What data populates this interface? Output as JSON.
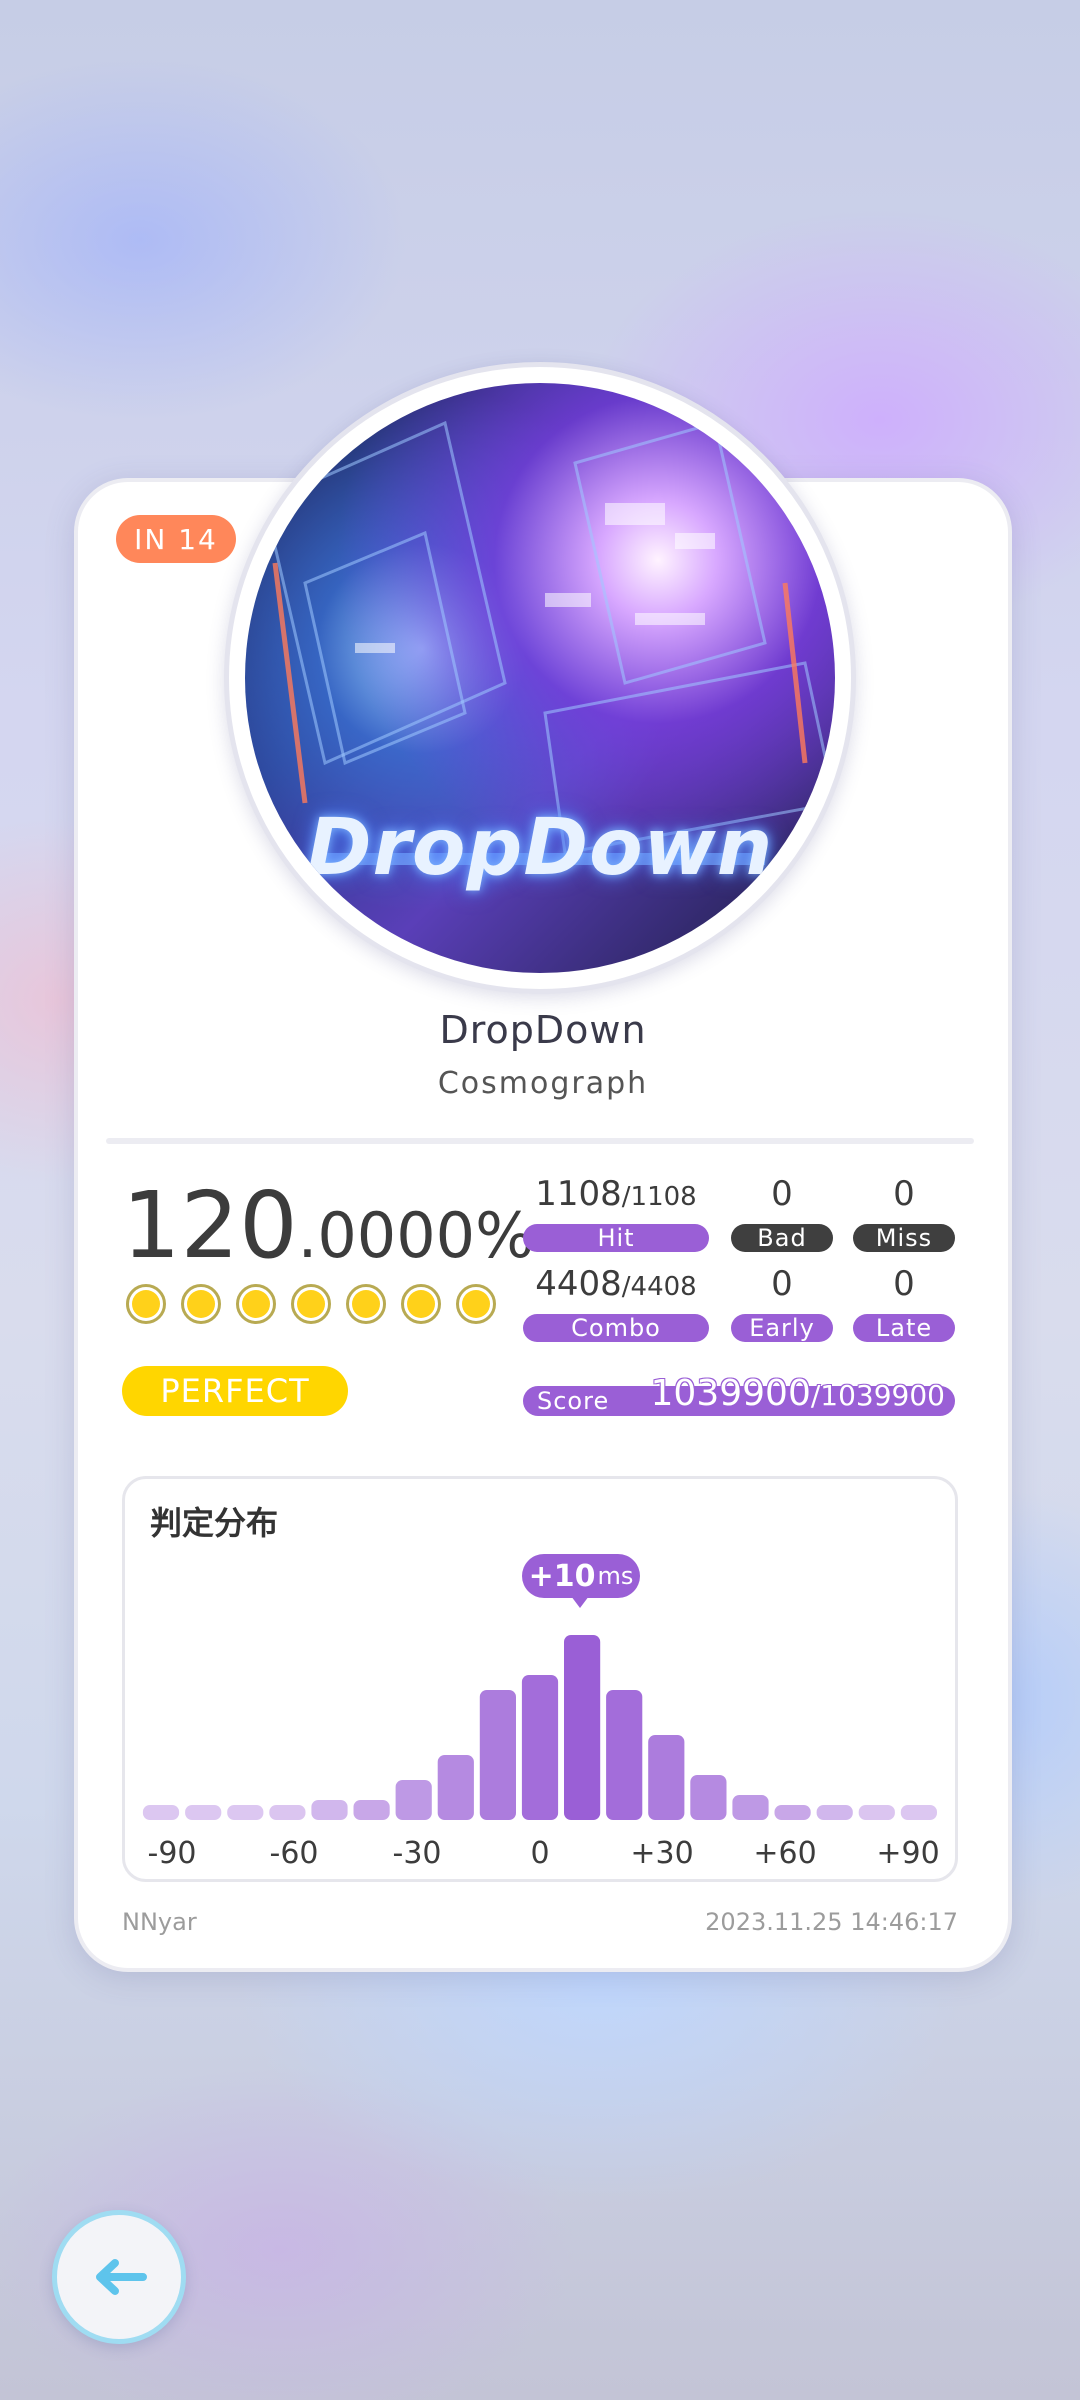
{
  "level": "IN  14",
  "song": {
    "jacket_text": "DropDown",
    "title": "DropDown",
    "artist": "Cosmograph"
  },
  "accuracy": {
    "integer": "120",
    "decimal": ".0000%"
  },
  "gems": {
    "count": 7,
    "filled": 7,
    "color": "#ffd11a"
  },
  "grade": "PERFECT",
  "stats": {
    "hit": {
      "value": "1108",
      "total": "/1108",
      "label": "Hit"
    },
    "bad": {
      "value": "0",
      "label": "Bad"
    },
    "miss": {
      "value": "0",
      "label": "Miss"
    },
    "combo": {
      "value": "4408",
      "total": "/4408",
      "label": "Combo"
    },
    "early": {
      "value": "0",
      "label": "Early"
    },
    "late": {
      "value": "0",
      "label": "Late"
    }
  },
  "score": {
    "label": "Score",
    "value": "1039900",
    "total": "/1039900"
  },
  "distribution": {
    "title": "判定分布",
    "offset": {
      "value": "+10",
      "unit": "ms"
    },
    "axis_labels": [
      "-90",
      "-60",
      "-30",
      "0",
      "+30",
      "+60",
      "+90"
    ]
  },
  "chart_data": {
    "type": "bar",
    "x": [
      -90,
      -80,
      -70,
      -60,
      -50,
      -40,
      -30,
      -20,
      -10,
      0,
      10,
      20,
      30,
      40,
      50,
      60,
      70,
      80,
      90
    ],
    "values": [
      3,
      3,
      3,
      3,
      4,
      4,
      8,
      13,
      26,
      29,
      37,
      26,
      17,
      9,
      5,
      3,
      3,
      3,
      3
    ],
    "xlabel": "",
    "ylabel": "",
    "ylim": [
      0,
      40
    ],
    "colors": {
      "bar": "#9a5fd6"
    }
  },
  "footer": {
    "player": "NNyar",
    "timestamp": "2023.11.25 14:46:17"
  },
  "colors": {
    "accent": "#9a5fd6",
    "level_badge": "#ff875a",
    "grade": "#ffd600",
    "back_button_ring": "#9fdcf2"
  },
  "icons": {
    "back": "arrow-left-icon"
  }
}
